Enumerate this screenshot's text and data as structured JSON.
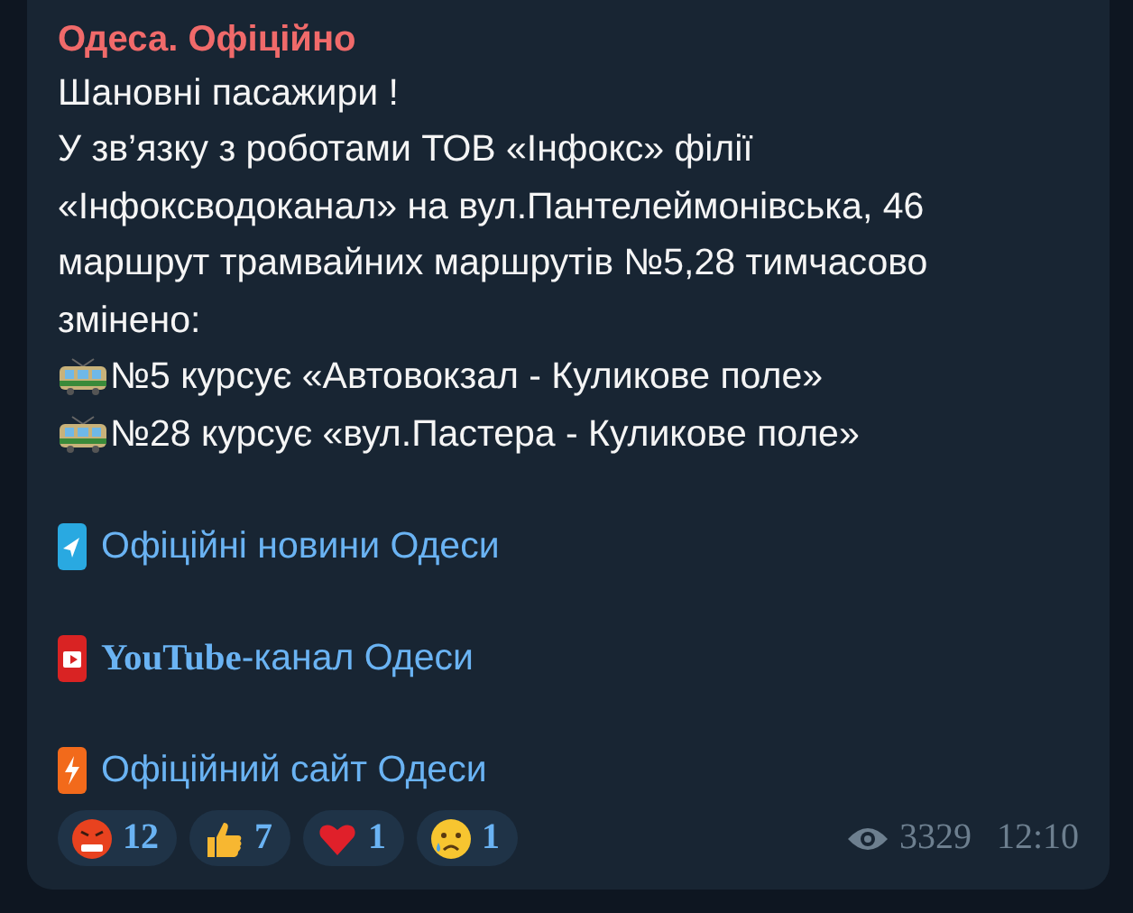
{
  "channel": {
    "title": "Одеса. Офіційно"
  },
  "lines": [
    {
      "kind": "text",
      "text": "Шановні пасажири !"
    },
    {
      "kind": "text",
      "text": "У зв’язку з роботами ТОВ «Інфокс» філії"
    },
    {
      "kind": "text",
      "text": "«Інфоксводоканал» на вул.Пантелеймонівська, 46"
    },
    {
      "kind": "text",
      "text": "маршрут трамвайних маршрутів №5,28 тимчасово"
    },
    {
      "kind": "text",
      "text": "змінено:"
    },
    {
      "kind": "tram",
      "text": "№5 курсує «Автовокзал - Куликове поле»"
    },
    {
      "kind": "tram",
      "text": "№28 курсує «вул.Пастера - Куликове поле»"
    }
  ],
  "links": [
    {
      "kind": "telegram",
      "text": "Офіційні новини Одеси"
    },
    {
      "kind": "youtube",
      "text": "**YouTube**-канал Одеси"
    },
    {
      "kind": "lightning",
      "text": "Офіційний сайт Одеси"
    }
  ],
  "reactions": [
    {
      "kind": "angry",
      "count": "12"
    },
    {
      "kind": "thumbs-up",
      "count": "7"
    },
    {
      "kind": "heart",
      "count": "1"
    },
    {
      "kind": "sad",
      "count": "1"
    }
  ],
  "footer": {
    "views": "3329",
    "time": "12:10"
  }
}
